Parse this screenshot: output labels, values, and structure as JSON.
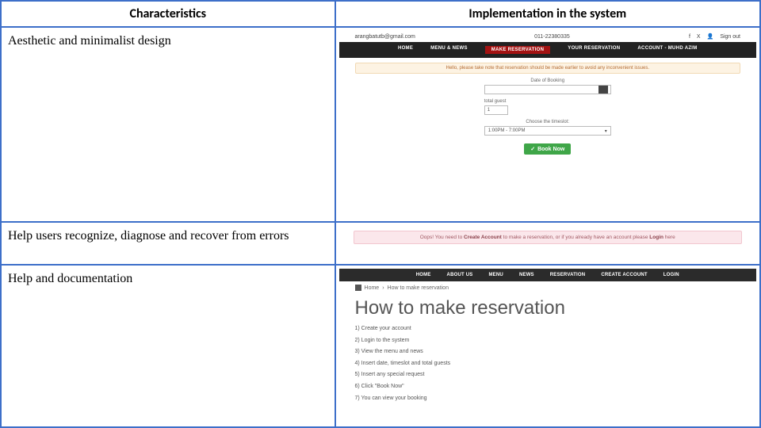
{
  "headers": {
    "left": "Characteristics",
    "right": "Implementation in the system"
  },
  "row1": {
    "label": "Aesthetic and minimalist design",
    "topbar": {
      "email": "arangbatutb@gmail.com",
      "phone": "011-22380335",
      "signout": "Sign out"
    },
    "nav": {
      "home": "HOME",
      "menu": "MENU & NEWS",
      "make": "MAKE RESERVATION",
      "your": "YOUR RESERVATION",
      "account": "ACCOUNT - MUHD AZIM"
    },
    "notice": "Hello, please take note that reservation should be made earlier to avoid any inconvenient issues.",
    "form": {
      "dateLabel": "Date of Booking",
      "guestLabel": "total guest",
      "guestValue": "1",
      "slotLabel": "Choose the timeslot:",
      "slotValue": "1:00PM - 7:00PM",
      "bookBtn": "Book Now"
    }
  },
  "row2": {
    "label": "Help users recognize, diagnose and recover from errors",
    "error": {
      "prefix": "Oops! You need to ",
      "b1": "Create Account",
      "mid": " to make a reservation, or if you already have an account please ",
      "b2": "Login",
      "suffix": " here"
    }
  },
  "row3": {
    "label": "Help and documentation",
    "nav": {
      "home": "HOME",
      "about": "ABOUT US",
      "menu": "MENU",
      "news": "NEWS",
      "reservation": "RESERVATION",
      "create": "CREATE ACCOUNT",
      "login": "LOGIN"
    },
    "crumbHome": "Home",
    "crumbNow": "How to make reservation",
    "title": "How to make reservation",
    "steps": {
      "s1": "1) Create your account",
      "s2": "2) Login to the system",
      "s3": "3) View the menu and news",
      "s4": "4) Insert date, timeslot and total guests",
      "s5": "5) Insert any special request",
      "s6": "6) Click \"Book Now\"",
      "s7": "7) You can view your booking"
    }
  }
}
